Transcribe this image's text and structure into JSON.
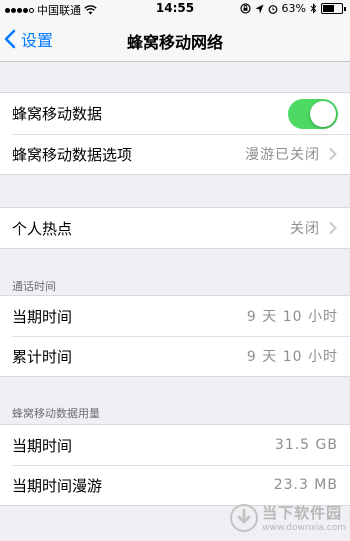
{
  "status_bar": {
    "carrier": "中国联通",
    "time": "14:55",
    "battery_percent": "63%",
    "battery_level": 0.63,
    "signal_bars_filled": 4,
    "icons": [
      "wifi-icon",
      "lock-rotation-icon",
      "location-icon",
      "alarm-icon",
      "bluetooth-icon",
      "battery-icon"
    ]
  },
  "nav": {
    "back_label": "设置",
    "title": "蜂窝移动网络"
  },
  "group1": {
    "cellular_data_label": "蜂窝移动数据",
    "cellular_data_on": true,
    "options_label": "蜂窝移动数据选项",
    "options_value": "漫游已关闭"
  },
  "group2": {
    "hotspot_label": "个人热点",
    "hotspot_value": "关闭"
  },
  "call_time": {
    "header": "通话时间",
    "current_label": "当期时间",
    "current_value": "9 天 10 小时",
    "total_label": "累计时间",
    "total_value": "9 天 10 小时"
  },
  "usage": {
    "header": "蜂窝移动数据用量",
    "current_label": "当期时间",
    "current_value": "31.5 GB",
    "roaming_label": "当期时间漫游",
    "roaming_value": "23.3 MB"
  },
  "watermark": {
    "main": "当下软件园",
    "sub": "www.downxia.com"
  },
  "colors": {
    "accent": "#007aff",
    "switch_on": "#4cd964",
    "background": "#efeff4"
  }
}
